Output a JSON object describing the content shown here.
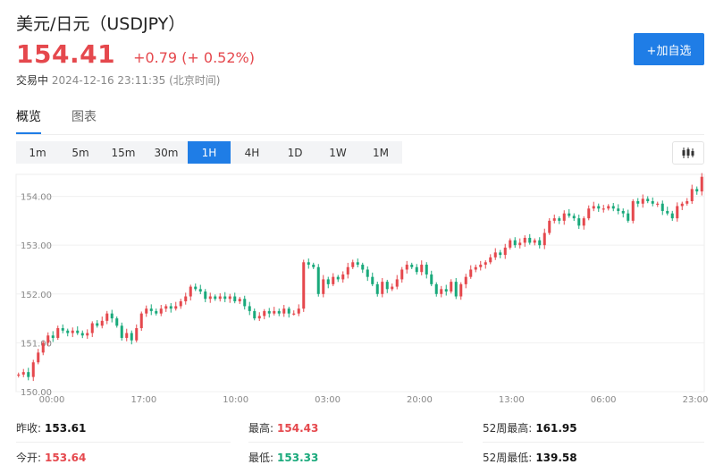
{
  "header": {
    "title": "美元/日元（USDJPY）",
    "price": "154.41",
    "change": "+0.79 (+ 0.52%)",
    "status": "交易中",
    "timestamp": "2024-12-16 23:11:35 (北京时间)",
    "watch_label": "+加自选"
  },
  "tabs": [
    "概览",
    "图表"
  ],
  "ranges": [
    "1m",
    "5m",
    "15m",
    "30m",
    "1H",
    "4H",
    "1D",
    "1W",
    "1M"
  ],
  "active_range": "1H",
  "stats": {
    "prev_close_label": "昨收:",
    "prev_close": "153.61",
    "open_label": "今开:",
    "open": "153.64",
    "high_label": "最高:",
    "high": "154.43",
    "low_label": "最低:",
    "low": "153.33",
    "w52_high_label": "52周最高:",
    "w52_high": "161.95",
    "w52_low_label": "52周最低:",
    "w52_low": "139.58"
  },
  "colors": {
    "up": "#e5484d",
    "down": "#19a97b",
    "accent": "#1f7de6"
  },
  "chart_data": {
    "type": "candlestick",
    "title": "",
    "x_ticks": [
      "00:00",
      "17:00",
      "10:00",
      "03:00",
      "20:00",
      "13:00",
      "06:00",
      "23:00"
    ],
    "y_ticks": [
      "150.00",
      "151.00",
      "152.00",
      "153.00",
      "154.00"
    ],
    "ylim": [
      150.0,
      154.45
    ],
    "grid": "horizontal",
    "closes": [
      150.35,
      150.4,
      150.3,
      150.6,
      150.8,
      151.0,
      151.15,
      151.1,
      151.3,
      151.25,
      151.2,
      151.25,
      151.2,
      151.15,
      151.2,
      151.4,
      151.35,
      151.45,
      151.6,
      151.5,
      151.35,
      151.1,
      151.2,
      151.05,
      151.3,
      151.6,
      151.7,
      151.65,
      151.6,
      151.7,
      151.75,
      151.7,
      151.75,
      151.85,
      151.95,
      152.15,
      152.1,
      152.05,
      151.9,
      151.95,
      151.9,
      151.95,
      151.9,
      151.95,
      151.85,
      151.9,
      151.75,
      151.65,
      151.5,
      151.55,
      151.65,
      151.6,
      151.65,
      151.6,
      151.7,
      151.6,
      151.6,
      151.7,
      152.65,
      152.6,
      152.55,
      152.0,
      152.3,
      152.2,
      152.35,
      152.3,
      152.4,
      152.55,
      152.65,
      152.6,
      152.5,
      152.35,
      152.2,
      152.0,
      152.25,
      152.1,
      152.15,
      152.3,
      152.5,
      152.6,
      152.55,
      152.45,
      152.6,
      152.4,
      152.2,
      152.0,
      152.1,
      152.05,
      152.25,
      151.95,
      152.2,
      152.35,
      152.5,
      152.55,
      152.6,
      152.65,
      152.75,
      152.85,
      152.8,
      152.95,
      153.1,
      153.0,
      153.05,
      153.15,
      153.05,
      153.1,
      153.0,
      153.25,
      153.5,
      153.55,
      153.5,
      153.65,
      153.6,
      153.55,
      153.4,
      153.55,
      153.75,
      153.8,
      153.75,
      153.75,
      153.8,
      153.75,
      153.7,
      153.65,
      153.5,
      153.9,
      153.85,
      153.95,
      153.9,
      153.85,
      153.85,
      153.7,
      153.65,
      153.55,
      153.8,
      153.85,
      153.9,
      154.15,
      154.1,
      154.4
    ]
  }
}
